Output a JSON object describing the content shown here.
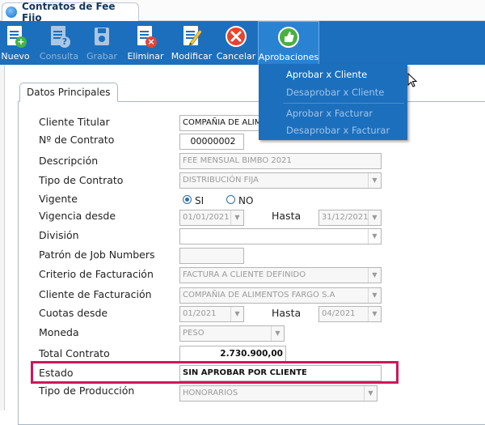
{
  "window": {
    "title": "Contratos de Fee Fijo"
  },
  "toolbar": {
    "buttons": [
      {
        "label": "Nuevo",
        "enabled": true,
        "icon": "new-document-icon"
      },
      {
        "label": "Consulta",
        "enabled": false,
        "icon": "query-document-icon"
      },
      {
        "label": "Grabar",
        "enabled": false,
        "icon": "save-disk-icon"
      },
      {
        "label": "Eliminar",
        "enabled": true,
        "icon": "delete-document-icon"
      },
      {
        "label": "Modificar",
        "enabled": true,
        "icon": "edit-pencil-icon"
      },
      {
        "label": "Cancelar",
        "enabled": true,
        "icon": "cancel-icon"
      },
      {
        "label": "Aprobaciones",
        "enabled": true,
        "active": true,
        "icon": "thumbs-up-icon"
      }
    ]
  },
  "menu": {
    "items": [
      {
        "label": "Aprobar x Cliente",
        "enabled": true
      },
      {
        "label": "Desaprobar x Cliente",
        "enabled": false
      },
      {
        "label": "Aprobar x Facturar",
        "enabled": false
      },
      {
        "label": "Desaprobar x Facturar",
        "enabled": false
      }
    ]
  },
  "panel": {
    "tab": "Datos Principales"
  },
  "form": {
    "cliente_titular": {
      "label": "Cliente Titular",
      "value": "COMPAÑIA DE ALIMENTOS FARGO S.A"
    },
    "numero_contrato": {
      "label": "Nº de Contrato",
      "value": "00000002"
    },
    "descripcion": {
      "label": "Descripción",
      "value": "FEE MENSUAL BIMBO 2021"
    },
    "tipo_contrato": {
      "label": "Tipo de Contrato",
      "value": "DISTRIBUCIÓN FIJA"
    },
    "vigente": {
      "label": "Vigente",
      "option_si": "SI",
      "option_no": "NO",
      "selected": "SI"
    },
    "vigencia_desde": {
      "label": "Vigencia desde",
      "value": "01/01/2021",
      "hasta_label": "Hasta",
      "hasta_value": "31/12/2021"
    },
    "division": {
      "label": "División",
      "value": ""
    },
    "patron_job": {
      "label": "Patrón de Job Numbers",
      "value": ""
    },
    "criterio_facturacion": {
      "label": "Criterio de Facturación",
      "value": "FACTURA A CLIENTE DEFINIDO"
    },
    "cliente_facturacion": {
      "label": "Cliente de Facturación",
      "value": "COMPAÑIA DE ALIMENTOS FARGO S.A"
    },
    "cuotas_desde": {
      "label": "Cuotas desde",
      "value": "01/2021",
      "hasta_label": "Hasta",
      "hasta_value": "04/2021"
    },
    "moneda": {
      "label": "Moneda",
      "value": "PESO"
    },
    "total_contrato": {
      "label": "Total Contrato",
      "value": "2.730.900,00"
    },
    "estado": {
      "label": "Estado",
      "value": "SIN APROBAR POR CLIENTE"
    },
    "tipo_produccion": {
      "label": "Tipo de Producción",
      "value": "HONORARIOS"
    }
  },
  "colors": {
    "toolbar": "#1c6fbc",
    "highlight": "#d3145a",
    "menu_enabled": "#ffffff",
    "menu_disabled": "#9fc4e8"
  }
}
